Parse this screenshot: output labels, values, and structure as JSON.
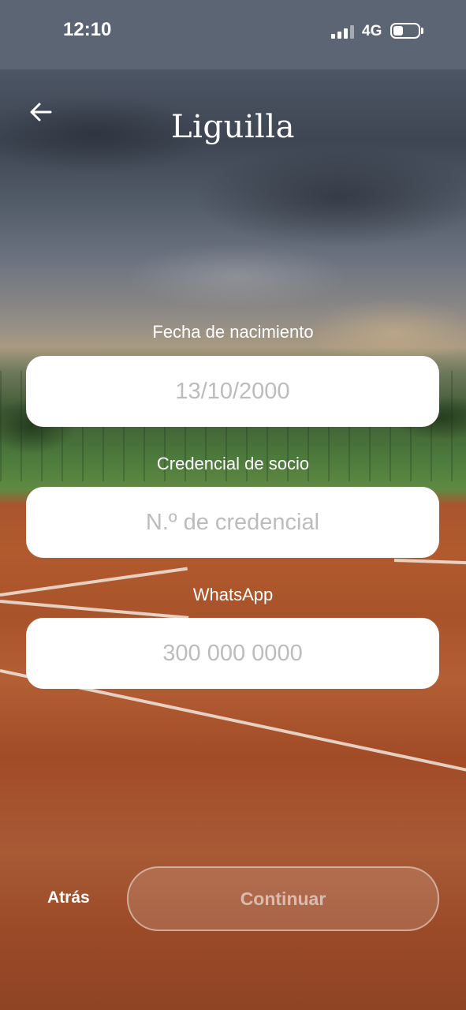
{
  "status_bar": {
    "time": "12:10",
    "network": "4G"
  },
  "header": {
    "title": "Liguilla",
    "back_icon": "arrow-left-icon"
  },
  "form": {
    "birthdate": {
      "label": "Fecha de nacimiento",
      "placeholder": "13/10/2000"
    },
    "credential": {
      "label": "Credencial de socio",
      "placeholder": "N.º de credencial"
    },
    "whatsapp": {
      "label": "WhatsApp",
      "placeholder": "300 000 0000"
    }
  },
  "footer": {
    "back_label": "Atrás",
    "continue_label": "Continuar"
  }
}
